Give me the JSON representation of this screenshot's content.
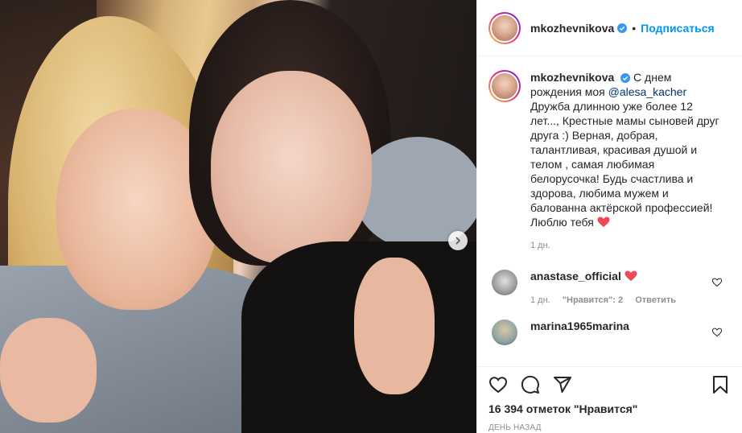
{
  "post": {
    "author": "mkozhevnikova",
    "follow_label": "Подписаться",
    "separator": "•",
    "caption": {
      "line1": "С днем рождения моя",
      "mention": "@alesa_kacher",
      "text": "Дружба длинною уже более 12 лет..., Крестные мамы сыновей друг друга :) Верная, добрая, талантливая, красивая душой и телом , самая любимая белорусочка! Будь счастлива и здорова, любима мужем и балованна актёрской профессией! Люблю тебя"
    },
    "caption_age": "1 дн.",
    "comments": [
      {
        "username": "anastase_official",
        "age": "1 дн.",
        "likes": "\"Нравится\": 2",
        "reply": "Ответить"
      },
      {
        "username": "marina1965marina"
      }
    ],
    "likes_count": "16 394 отметок \"Нравится\"",
    "date_label": "ДЕНЬ НАЗАД"
  },
  "colors": {
    "accent": "#0095f6",
    "heart": "#ed4956",
    "muted": "#8e8e8e"
  },
  "icons": [
    "verified-icon",
    "heart-icon",
    "comment-icon",
    "share-icon",
    "bookmark-icon",
    "chevron-right-icon"
  ]
}
